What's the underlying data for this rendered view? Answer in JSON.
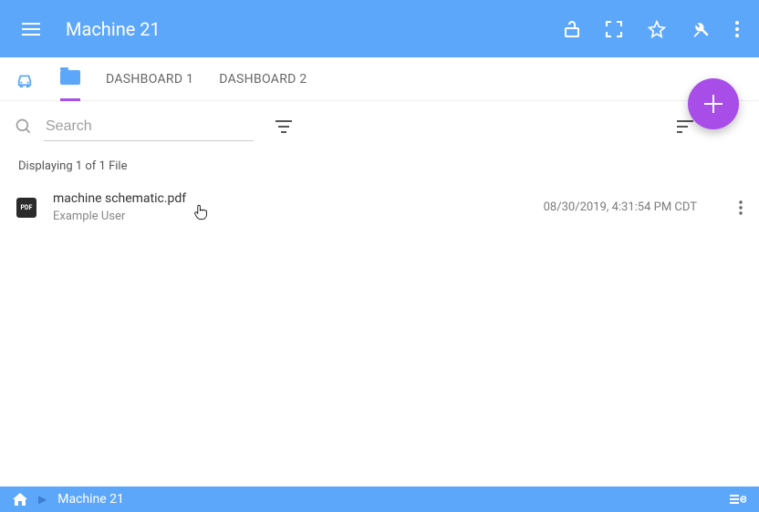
{
  "appbar": {
    "title": "Machine 21"
  },
  "tabs": {
    "dashboard1": "DASHBOARD 1",
    "dashboard2": "DASHBOARD 2"
  },
  "search": {
    "placeholder": "Search"
  },
  "listing": {
    "count_text": "Displaying 1 of 1 File"
  },
  "file": {
    "badge": "PDF",
    "name": "machine schematic.pdf",
    "owner": "Example User",
    "date": "08/30/2019, 4:31:54 PM CDT"
  },
  "breadcrumb": {
    "current": "Machine 21"
  }
}
